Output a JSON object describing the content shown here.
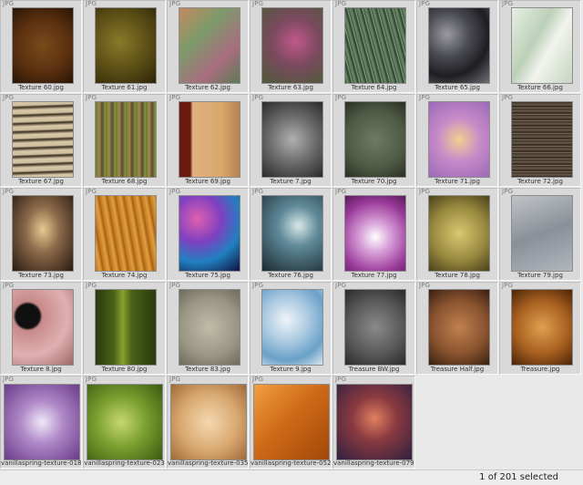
{
  "status": {
    "selection_text": "1 of 201 selected"
  },
  "colors": {
    "background": "#e9e9e9",
    "cell": "#d9d9d9",
    "selected": "#c8d6ea"
  },
  "thumbnails": [
    {
      "name": "Texture 60.jpg",
      "badge": "JPG",
      "bg": "radial-gradient(circle at 50% 50%, #7a4a1a 0%, #5a3010 55%, #2a1505 100%)"
    },
    {
      "name": "Texture 61.jpg",
      "badge": "JPG",
      "bg": "radial-gradient(circle at 40% 45%, #8a7a2a 0%, #5e5016 50%, #2c2608 100%)"
    },
    {
      "name": "Texture 62.jpg",
      "badge": "JPG",
      "bg": "linear-gradient(135deg, #c2895f 0%, #7d9a6a 35%, #a86d7e 70%, #5d7a55 100%)"
    },
    {
      "name": "Texture 63.jpg",
      "badge": "JPG",
      "bg": "radial-gradient(circle at 55% 45%, #c0588a 0%, #7a4a5e 45%, #4e5a3a 100%)"
    },
    {
      "name": "Texture 64.jpg",
      "badge": "JPG",
      "bg": "repeating-linear-gradient(75deg, #3a5a3a 0px, #6e8a6a 3px, #2a3e2a 6px, #98b098 8px)"
    },
    {
      "name": "Texture 65.jpg",
      "badge": "JPG",
      "bg": "radial-gradient(circle at 30% 35%, #9a9aa0 0%, #4a4a52 35%, #1e1e22 65%, #6e6e76 100%)"
    },
    {
      "name": "Texture 66.jpg",
      "badge": "JPG",
      "bg": "linear-gradient(120deg, #e6efe2 0%, #bcd0b8 40%, #f2f4ee 60%, #c4d4be 100%)"
    },
    {
      "name": "Texture 67.jpg",
      "badge": "JPG",
      "bg": "repeating-linear-gradient(178deg, #d8c8a8 0px, #d0bf9e 4px, #3a2e20 6px, #cbb99a 9px)"
    },
    {
      "name": "Texture 68.jpg",
      "badge": "JPG",
      "bg": "repeating-linear-gradient(90deg, #6a7a2a 0px, #a08a4a 4px, #5a4a3a 7px, #8a9a3a 11px)"
    },
    {
      "name": "Texture 69.jpg",
      "badge": "JPG",
      "bg": "linear-gradient(90deg, #6a1a10 0%, #6a1a10 18%, #e0b080 22%, #d8a86a 70%, #b88050 100%)"
    },
    {
      "name": "Texture 7.jpg",
      "badge": "JPG",
      "bg": "radial-gradient(circle at 50% 50%, #b0b0b0 0%, #6a6a6a 50%, #2a2a2a 100%)"
    },
    {
      "name": "Texture 70.jpg",
      "badge": "JPG",
      "bg": "radial-gradient(circle at 50% 50%, #6e7a62 0%, #4e5a44 60%, #2a3022 100%)"
    },
    {
      "name": "Texture 71.jpg",
      "badge": "JPG",
      "bg": "radial-gradient(circle at 50% 50%, #f0d090 0%, #c88ac8 45%, #9a6ab8 100%)"
    },
    {
      "name": "Texture 72.jpg",
      "badge": "JPG",
      "bg": "repeating-linear-gradient(180deg, #3a3028 0px, #6a5a48 3px, #2a221a 5px, #8a7a62 7px)"
    },
    {
      "name": "Texture 73.jpg",
      "badge": "JPG",
      "bg": "radial-gradient(ellipse at 50% 45%, #e8c890 0%, #8a6a4a 40%, #2a1a12 100%)"
    },
    {
      "name": "Texture 74.jpg",
      "badge": "JPG",
      "bg": "repeating-linear-gradient(80deg, #c07018 0px, #e0a040 5px, #a05810 9px)"
    },
    {
      "name": "Texture 75.jpg",
      "badge": "JPG",
      "bg": "radial-gradient(circle at 30% 30%, #e060b0 0%, #8040c0 35%, #2080c0 65%, #101040 100%)"
    },
    {
      "name": "Texture 76.jpg",
      "badge": "JPG",
      "bg": "radial-gradient(circle at 60% 40%, #d8e8e8 0%, #608a9a 35%, #1a2a30 100%)"
    },
    {
      "name": "Texture 77.jpg",
      "badge": "JPG",
      "bg": "radial-gradient(circle at 50% 55%, #ffffff 0%, #d8a0d8 30%, #9a3a9a 70%, #5a1a5a 100%)"
    },
    {
      "name": "Texture 78.jpg",
      "badge": "JPG",
      "bg": "radial-gradient(circle at 50% 50%, #d8c870 0%, #9a8a40 55%, #4a4018 100%)"
    },
    {
      "name": "Texture 79.jpg",
      "badge": "JPG",
      "bg": "linear-gradient(160deg, #c0c4c8 0%, #8a9098 50%, #b0b6bc 100%)"
    },
    {
      "name": "Texture 8.jpg",
      "badge": "JPG",
      "bg": "radial-gradient(circle at 25% 35%, #101010 0%, #101010 18%, #c88a8a 22%, #e0b0b0 60%, #a06868 100%)"
    },
    {
      "name": "Texture 80.jpg",
      "badge": "JPG",
      "bg": "linear-gradient(90deg, #2a3a10 0%, #4a6018 30%, #8aa030 45%, #4a6018 60%, #2a3a10 100%)"
    },
    {
      "name": "Texture 83.jpg",
      "badge": "JPG",
      "bg": "radial-gradient(circle at 50% 50%, #c0bca8 0%, #9a9684 60%, #6e6a5c 100%)"
    },
    {
      "name": "Texture 9.jpg",
      "badge": "JPG",
      "bg": "radial-gradient(circle at 40% 40%, #f0f4f8 0%, #a8c8e0 40%, #6aa0c8 70%, #d8e6f0 100%)"
    },
    {
      "name": "Treasure BW.jpg",
      "badge": "JPG",
      "bg": "radial-gradient(circle at 50% 50%, #8a8a8a 0%, #5a5a5a 55%, #2a2a2a 100%)"
    },
    {
      "name": "Treasure Half.jpg",
      "badge": "JPG",
      "bg": "radial-gradient(circle at 50% 50%, #c08050 0%, #8a5430 55%, #3a2010 100%)"
    },
    {
      "name": "Treasure.jpg",
      "badge": "JPG",
      "bg": "radial-gradient(circle at 50% 50%, #e0a050 0%, #a86020 55%, #4a2408 100%)"
    },
    {
      "name": "vanillaspring-texture-018",
      "badge": "JPG",
      "bg": "radial-gradient(circle at 50% 50%, #f0e8f8 0%, #b08ac8 40%, #6a3a8a 100%)"
    },
    {
      "name": "vanillaspring-texture-023",
      "badge": "JPG",
      "bg": "radial-gradient(circle at 45% 50%, #c8d870 0%, #7aa030 45%, #3a5a10 100%)"
    },
    {
      "name": "vanillaspring-texture-035",
      "badge": "JPG",
      "bg": "radial-gradient(circle at 50% 50%, #f4d8b0 0%, #d8a870 55%, #a06a38 100%)"
    },
    {
      "name": "vanillaspring-texture-052",
      "badge": "JPG",
      "bg": "linear-gradient(135deg, #f0a040 0%, #d06a18 45%, #a04808 100%)"
    },
    {
      "name": "vanillaspring-texture-079.jpg",
      "badge": "JPG",
      "bg": "radial-gradient(circle at 50% 45%, #e08060 0%, #8a3a40 40%, #302040 100%)"
    }
  ]
}
